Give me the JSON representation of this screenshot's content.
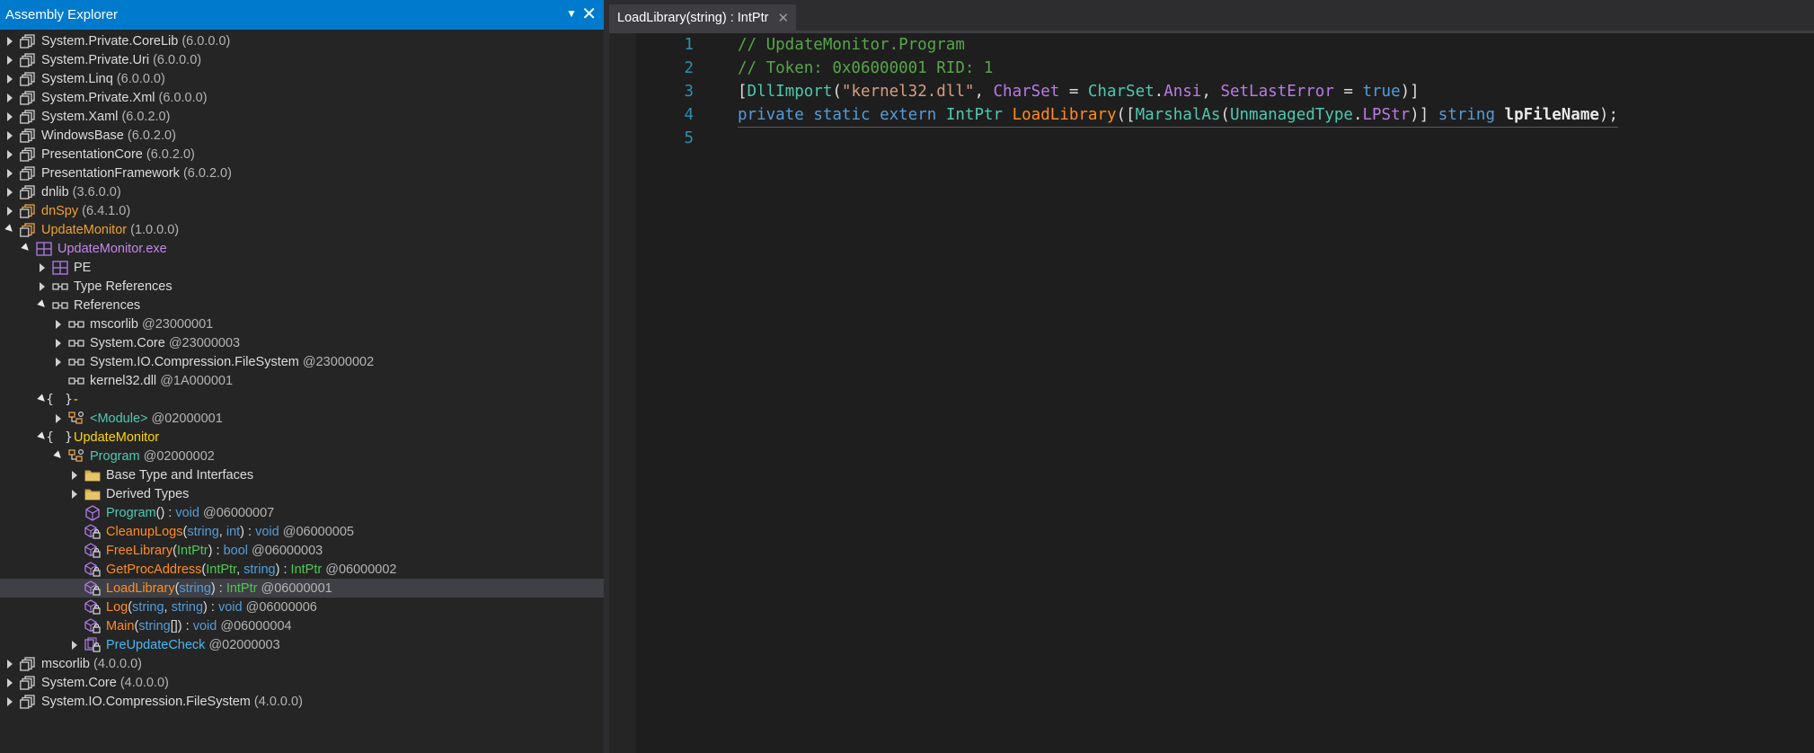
{
  "panel": {
    "title": "Assembly Explorer",
    "dropdown_glyph": "▼",
    "close_glyph": "✕"
  },
  "tree": [
    {
      "indent": 0,
      "exp": "collapsed",
      "icon": "assembly",
      "parts": [
        {
          "t": "System.Private.CoreLib",
          "c": "white"
        },
        {
          "t": " (6.0.0.0)",
          "c": "gray"
        }
      ]
    },
    {
      "indent": 0,
      "exp": "collapsed",
      "icon": "assembly",
      "parts": [
        {
          "t": "System.Private.Uri",
          "c": "white"
        },
        {
          "t": " (6.0.0.0)",
          "c": "gray"
        }
      ]
    },
    {
      "indent": 0,
      "exp": "collapsed",
      "icon": "assembly",
      "parts": [
        {
          "t": "System.Linq",
          "c": "white"
        },
        {
          "t": " (6.0.0.0)",
          "c": "gray"
        }
      ]
    },
    {
      "indent": 0,
      "exp": "collapsed",
      "icon": "assembly",
      "parts": [
        {
          "t": "System.Private.Xml",
          "c": "white"
        },
        {
          "t": " (6.0.0.0)",
          "c": "gray"
        }
      ]
    },
    {
      "indent": 0,
      "exp": "collapsed",
      "icon": "assembly",
      "parts": [
        {
          "t": "System.Xaml",
          "c": "white"
        },
        {
          "t": " (6.0.2.0)",
          "c": "gray"
        }
      ]
    },
    {
      "indent": 0,
      "exp": "collapsed",
      "icon": "assembly",
      "parts": [
        {
          "t": "WindowsBase",
          "c": "white"
        },
        {
          "t": " (6.0.2.0)",
          "c": "gray"
        }
      ]
    },
    {
      "indent": 0,
      "exp": "collapsed",
      "icon": "assembly",
      "parts": [
        {
          "t": "PresentationCore",
          "c": "white"
        },
        {
          "t": " (6.0.2.0)",
          "c": "gray"
        }
      ]
    },
    {
      "indent": 0,
      "exp": "collapsed",
      "icon": "assembly",
      "parts": [
        {
          "t": "PresentationFramework",
          "c": "white"
        },
        {
          "t": " (6.0.2.0)",
          "c": "gray"
        }
      ]
    },
    {
      "indent": 0,
      "exp": "collapsed",
      "icon": "assembly",
      "parts": [
        {
          "t": "dnlib",
          "c": "white"
        },
        {
          "t": " (3.6.0.0)",
          "c": "gray"
        }
      ]
    },
    {
      "indent": 0,
      "exp": "collapsed",
      "icon": "assembly-orange",
      "parts": [
        {
          "t": "dnSpy",
          "c": "orange"
        },
        {
          "t": " (6.4.1.0)",
          "c": "gray"
        }
      ]
    },
    {
      "indent": 0,
      "exp": "expanded",
      "icon": "assembly-orange",
      "parts": [
        {
          "t": "UpdateMonitor",
          "c": "orange"
        },
        {
          "t": " (1.0.0.0)",
          "c": "gray"
        }
      ]
    },
    {
      "indent": 1,
      "exp": "expanded",
      "icon": "module",
      "parts": [
        {
          "t": "UpdateMonitor.exe",
          "c": "purple"
        }
      ]
    },
    {
      "indent": 2,
      "exp": "collapsed",
      "icon": "module",
      "parts": [
        {
          "t": "PE",
          "c": "white"
        }
      ]
    },
    {
      "indent": 2,
      "exp": "collapsed",
      "icon": "reference",
      "parts": [
        {
          "t": "Type References",
          "c": "white"
        }
      ]
    },
    {
      "indent": 2,
      "exp": "expanded",
      "icon": "reference",
      "parts": [
        {
          "t": "References",
          "c": "white"
        }
      ]
    },
    {
      "indent": 3,
      "exp": "collapsed",
      "icon": "reference",
      "parts": [
        {
          "t": "mscorlib",
          "c": "white"
        },
        {
          "t": " @23000001",
          "c": "gray"
        }
      ]
    },
    {
      "indent": 3,
      "exp": "collapsed",
      "icon": "reference",
      "parts": [
        {
          "t": "System.Core",
          "c": "white"
        },
        {
          "t": " @23000003",
          "c": "gray"
        }
      ]
    },
    {
      "indent": 3,
      "exp": "collapsed",
      "icon": "reference",
      "parts": [
        {
          "t": "System.IO.Compression.FileSystem",
          "c": "white"
        },
        {
          "t": " @23000002",
          "c": "gray"
        }
      ]
    },
    {
      "indent": 3,
      "exp": "none",
      "icon": "reference",
      "parts": [
        {
          "t": "kernel32.dll",
          "c": "white"
        },
        {
          "t": " @1A000001",
          "c": "gray"
        }
      ]
    },
    {
      "indent": 2,
      "exp": "expanded",
      "icon": "namespace",
      "parts": [
        {
          "t": "-",
          "c": "yellow"
        }
      ]
    },
    {
      "indent": 3,
      "exp": "collapsed",
      "icon": "class",
      "parts": [
        {
          "t": "<Module>",
          "c": "teal"
        },
        {
          "t": " @02000001",
          "c": "gray"
        }
      ]
    },
    {
      "indent": 2,
      "exp": "expanded",
      "icon": "namespace",
      "parts": [
        {
          "t": "UpdateMonitor",
          "c": "yellow"
        }
      ]
    },
    {
      "indent": 3,
      "exp": "expanded",
      "icon": "class",
      "parts": [
        {
          "t": "Program",
          "c": "teal"
        },
        {
          "t": " @02000002",
          "c": "gray"
        }
      ]
    },
    {
      "indent": 4,
      "exp": "collapsed",
      "icon": "folder",
      "parts": [
        {
          "t": "Base Type and Interfaces",
          "c": "white"
        }
      ]
    },
    {
      "indent": 4,
      "exp": "collapsed",
      "icon": "folder",
      "parts": [
        {
          "t": "Derived Types",
          "c": "white"
        }
      ]
    },
    {
      "indent": 4,
      "exp": "none",
      "icon": "method",
      "parts": [
        {
          "t": "Program",
          "c": "teal"
        },
        {
          "t": "() : ",
          "c": "white"
        },
        {
          "t": "void",
          "c": "blue"
        },
        {
          "t": " @06000007",
          "c": "gray"
        }
      ]
    },
    {
      "indent": 4,
      "exp": "none",
      "icon": "method-lock",
      "parts": [
        {
          "t": "CleanupLogs",
          "c": "method"
        },
        {
          "t": "(",
          "c": "white"
        },
        {
          "t": "string",
          "c": "blue"
        },
        {
          "t": ", ",
          "c": "white"
        },
        {
          "t": "int",
          "c": "blue"
        },
        {
          "t": ") : ",
          "c": "white"
        },
        {
          "t": "void",
          "c": "blue"
        },
        {
          "t": " @06000005",
          "c": "gray"
        }
      ]
    },
    {
      "indent": 4,
      "exp": "none",
      "icon": "method-lock",
      "parts": [
        {
          "t": "FreeLibrary",
          "c": "method"
        },
        {
          "t": "(",
          "c": "white"
        },
        {
          "t": "IntPtr",
          "c": "green"
        },
        {
          "t": ") : ",
          "c": "white"
        },
        {
          "t": "bool",
          "c": "blue"
        },
        {
          "t": " @06000003",
          "c": "gray"
        }
      ]
    },
    {
      "indent": 4,
      "exp": "none",
      "icon": "method-lock",
      "parts": [
        {
          "t": "GetProcAddress",
          "c": "method"
        },
        {
          "t": "(",
          "c": "white"
        },
        {
          "t": "IntPtr",
          "c": "green"
        },
        {
          "t": ", ",
          "c": "white"
        },
        {
          "t": "string",
          "c": "blue"
        },
        {
          "t": ") : ",
          "c": "white"
        },
        {
          "t": "IntPtr",
          "c": "green"
        },
        {
          "t": " @06000002",
          "c": "gray"
        }
      ]
    },
    {
      "indent": 4,
      "exp": "none",
      "icon": "method-lock",
      "selected": true,
      "parts": [
        {
          "t": "LoadLibrary",
          "c": "method"
        },
        {
          "t": "(",
          "c": "white"
        },
        {
          "t": "string",
          "c": "blue"
        },
        {
          "t": ") : ",
          "c": "white"
        },
        {
          "t": "IntPtr",
          "c": "green"
        },
        {
          "t": " @06000001",
          "c": "gray"
        }
      ]
    },
    {
      "indent": 4,
      "exp": "none",
      "icon": "method-lock",
      "parts": [
        {
          "t": "Log",
          "c": "method"
        },
        {
          "t": "(",
          "c": "white"
        },
        {
          "t": "string",
          "c": "blue"
        },
        {
          "t": ", ",
          "c": "white"
        },
        {
          "t": "string",
          "c": "blue"
        },
        {
          "t": ") : ",
          "c": "white"
        },
        {
          "t": "void",
          "c": "blue"
        },
        {
          "t": " @06000006",
          "c": "gray"
        }
      ]
    },
    {
      "indent": 4,
      "exp": "none",
      "icon": "method-lock",
      "parts": [
        {
          "t": "Main",
          "c": "method"
        },
        {
          "t": "(",
          "c": "white"
        },
        {
          "t": "string",
          "c": "blue"
        },
        {
          "t": "[]) : ",
          "c": "white"
        },
        {
          "t": "void",
          "c": "blue"
        },
        {
          "t": " @06000004",
          "c": "gray"
        }
      ]
    },
    {
      "indent": 4,
      "exp": "collapsed",
      "icon": "nested-class",
      "parts": [
        {
          "t": "PreUpdateCheck",
          "c": "cyan"
        },
        {
          "t": " @02000003",
          "c": "gray"
        }
      ]
    },
    {
      "indent": 0,
      "exp": "collapsed",
      "icon": "assembly",
      "parts": [
        {
          "t": "mscorlib",
          "c": "white"
        },
        {
          "t": " (4.0.0.0)",
          "c": "gray"
        }
      ]
    },
    {
      "indent": 0,
      "exp": "collapsed",
      "icon": "assembly",
      "parts": [
        {
          "t": "System.Core",
          "c": "white"
        },
        {
          "t": " (4.0.0.0)",
          "c": "gray"
        }
      ]
    },
    {
      "indent": 0,
      "exp": "collapsed",
      "icon": "assembly",
      "parts": [
        {
          "t": "System.IO.Compression.FileSystem",
          "c": "white"
        },
        {
          "t": " (4.0.0.0)",
          "c": "gray"
        }
      ]
    }
  ],
  "editor": {
    "tab_label": "LoadLibrary(string) : IntPtr",
    "tab_close": "✕",
    "lines": [
      {
        "n": "1",
        "tokens": [
          {
            "t": "// UpdateMonitor.Program",
            "k": "com"
          }
        ]
      },
      {
        "n": "2",
        "tokens": [
          {
            "t": "// Token: 0x06000001 RID: 1",
            "k": "com"
          }
        ]
      },
      {
        "n": "3",
        "tokens": [
          {
            "t": "[",
            "k": "id"
          },
          {
            "t": "DllImport",
            "k": "type"
          },
          {
            "t": "(",
            "k": "id"
          },
          {
            "t": "\"kernel32.dll\"",
            "k": "str"
          },
          {
            "t": ", ",
            "k": "id"
          },
          {
            "t": "CharSet",
            "k": "prop"
          },
          {
            "t": " = ",
            "k": "id"
          },
          {
            "t": "CharSet",
            "k": "type"
          },
          {
            "t": ".",
            "k": "id"
          },
          {
            "t": "Ansi",
            "k": "prop"
          },
          {
            "t": ", ",
            "k": "id"
          },
          {
            "t": "SetLastError",
            "k": "prop"
          },
          {
            "t": " = ",
            "k": "id"
          },
          {
            "t": "true",
            "k": "kw"
          },
          {
            "t": ")]",
            "k": "id"
          }
        ]
      },
      {
        "n": "4",
        "current": true,
        "tokens": [
          {
            "t": "private",
            "k": "kw"
          },
          {
            "t": " ",
            "k": "id"
          },
          {
            "t": "static",
            "k": "kw"
          },
          {
            "t": " ",
            "k": "id"
          },
          {
            "t": "extern",
            "k": "kw"
          },
          {
            "t": " ",
            "k": "id"
          },
          {
            "t": "IntPtr",
            "k": "type"
          },
          {
            "t": " ",
            "k": "id"
          },
          {
            "t": "LoadLibrary",
            "k": "meth"
          },
          {
            "t": "([",
            "k": "id"
          },
          {
            "t": "MarshalAs",
            "k": "type"
          },
          {
            "t": "(",
            "k": "id"
          },
          {
            "t": "UnmanagedType",
            "k": "type"
          },
          {
            "t": ".",
            "k": "id"
          },
          {
            "t": "LPStr",
            "k": "prop"
          },
          {
            "t": ")] ",
            "k": "id"
          },
          {
            "t": "string",
            "k": "kw"
          },
          {
            "t": " ",
            "k": "id"
          },
          {
            "t": "lpFileName",
            "k": "param"
          },
          {
            "t": ");",
            "k": "id"
          }
        ]
      },
      {
        "n": "5",
        "tokens": []
      }
    ]
  },
  "colors": {
    "accent": "#007acc",
    "selection": "#3f3f46"
  }
}
